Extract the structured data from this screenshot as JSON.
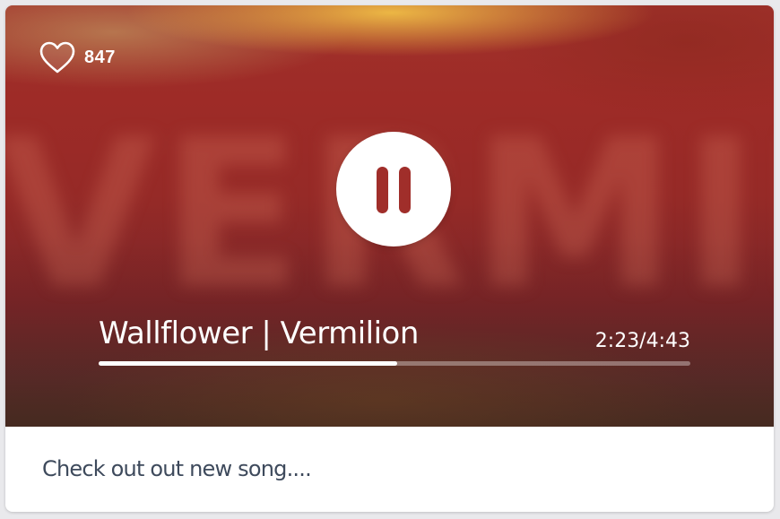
{
  "player": {
    "likes": {
      "icon": "heart-outline-icon",
      "count": "847"
    },
    "control": {
      "icon": "pause-icon",
      "state": "playing"
    },
    "track_title": "Wallflower | Vermilion",
    "time_display": "2:23/4:43",
    "progress": {
      "elapsed_seconds": 143,
      "total_seconds": 283,
      "fraction": 0.505
    },
    "colors": {
      "accent": "#a02e2a",
      "progress_fill": "#ffffff"
    }
  },
  "post": {
    "caption": "Check out out new song...."
  }
}
